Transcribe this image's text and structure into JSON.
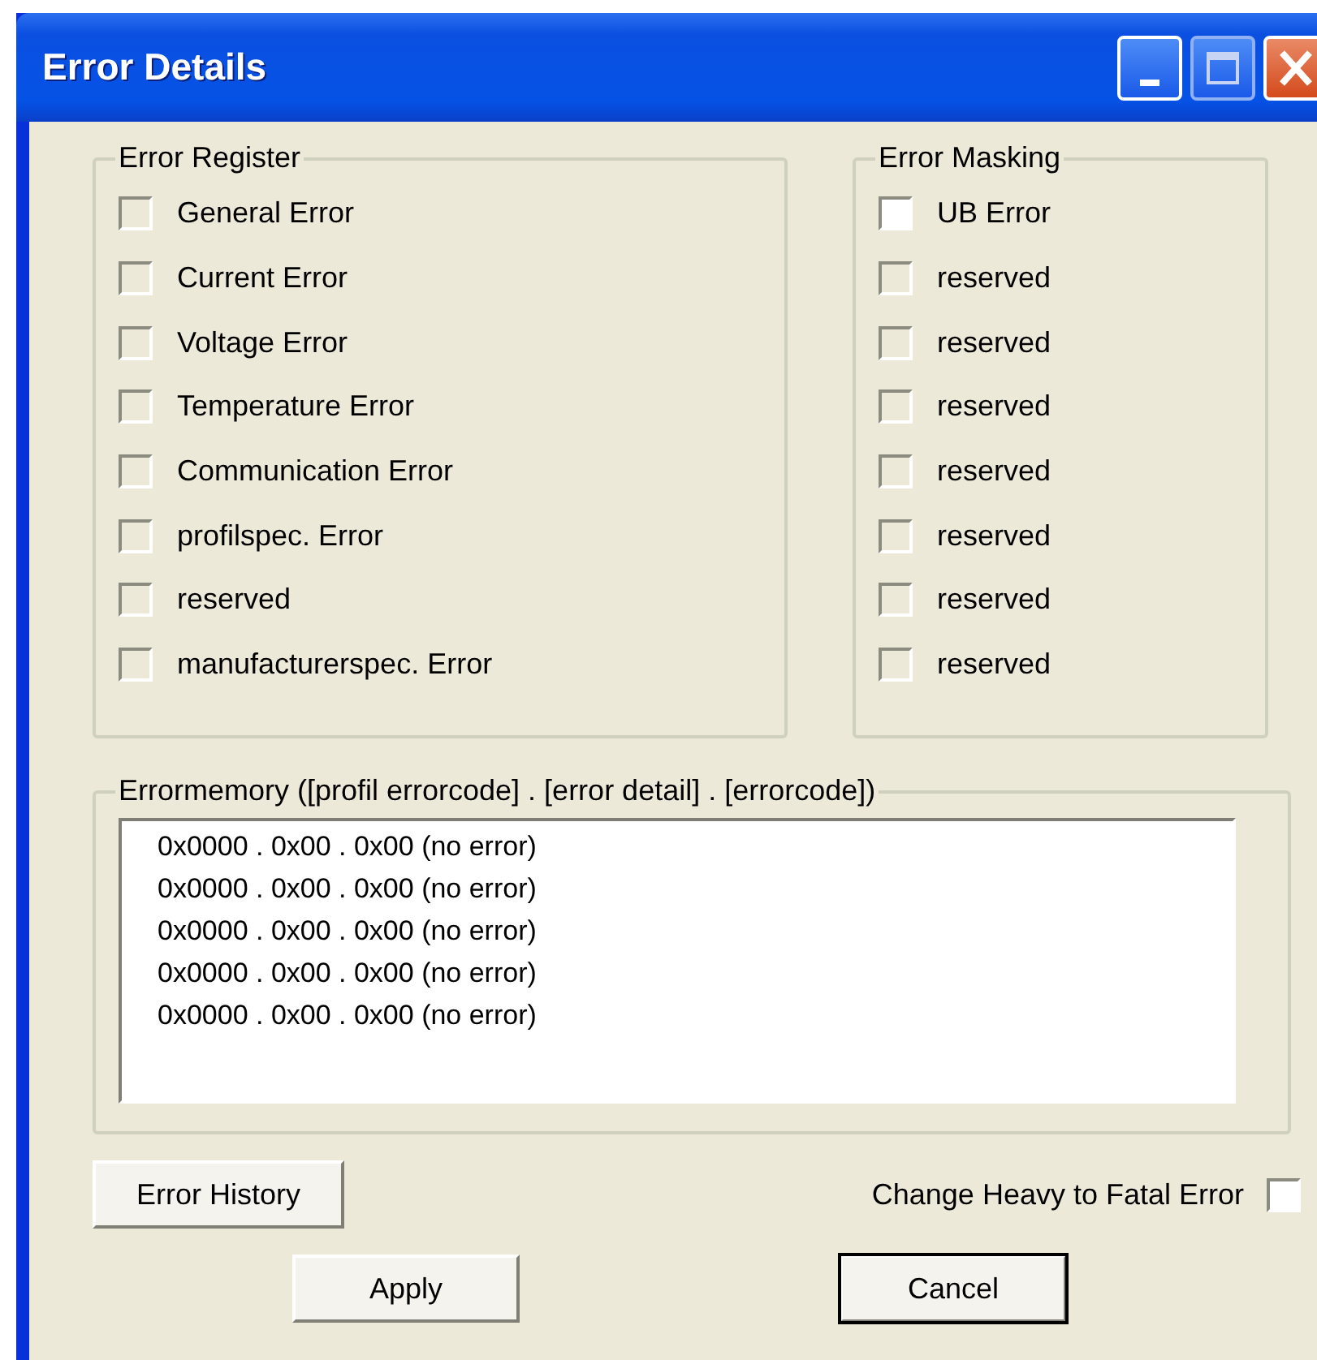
{
  "window": {
    "title": "Error Details"
  },
  "error_register": {
    "title": "Error Register",
    "items": [
      {
        "label": "General Error",
        "checked": false,
        "disabled": true
      },
      {
        "label": "Current Error",
        "checked": false,
        "disabled": true
      },
      {
        "label": "Voltage Error",
        "checked": false,
        "disabled": true
      },
      {
        "label": "Temperature Error",
        "checked": false,
        "disabled": true
      },
      {
        "label": "Communication Error",
        "checked": false,
        "disabled": true
      },
      {
        "label": "profilspec. Error",
        "checked": false,
        "disabled": true
      },
      {
        "label": "reserved",
        "checked": false,
        "disabled": true
      },
      {
        "label": "manufacturerspec. Error",
        "checked": false,
        "disabled": true
      }
    ]
  },
  "error_masking": {
    "title": "Error Masking",
    "items": [
      {
        "label": "UB Error",
        "checked": false,
        "disabled": false
      },
      {
        "label": "reserved",
        "checked": false,
        "disabled": true
      },
      {
        "label": "reserved",
        "checked": false,
        "disabled": true
      },
      {
        "label": "reserved",
        "checked": false,
        "disabled": true
      },
      {
        "label": "reserved",
        "checked": false,
        "disabled": true
      },
      {
        "label": "reserved",
        "checked": false,
        "disabled": true
      },
      {
        "label": "reserved",
        "checked": false,
        "disabled": true
      },
      {
        "label": "reserved",
        "checked": false,
        "disabled": true
      }
    ]
  },
  "error_memory": {
    "title": "Errormemory ([profil errorcode] . [error detail] . [errorcode])",
    "entries": [
      "0x0000 . 0x00 . 0x00 (no error)",
      "0x0000 . 0x00 . 0x00 (no error)",
      "0x0000 . 0x00 . 0x00 (no error)",
      "0x0000 . 0x00 . 0x00 (no error)",
      "0x0000 . 0x00 . 0x00 (no error)"
    ]
  },
  "error_history_button": "Error History",
  "fatal_option": {
    "label": "Change Heavy to Fatal Error",
    "checked": false,
    "disabled": false
  },
  "buttons": [
    {
      "label": "Apply",
      "default": false
    },
    {
      "label": "Cancel",
      "default": true
    }
  ]
}
